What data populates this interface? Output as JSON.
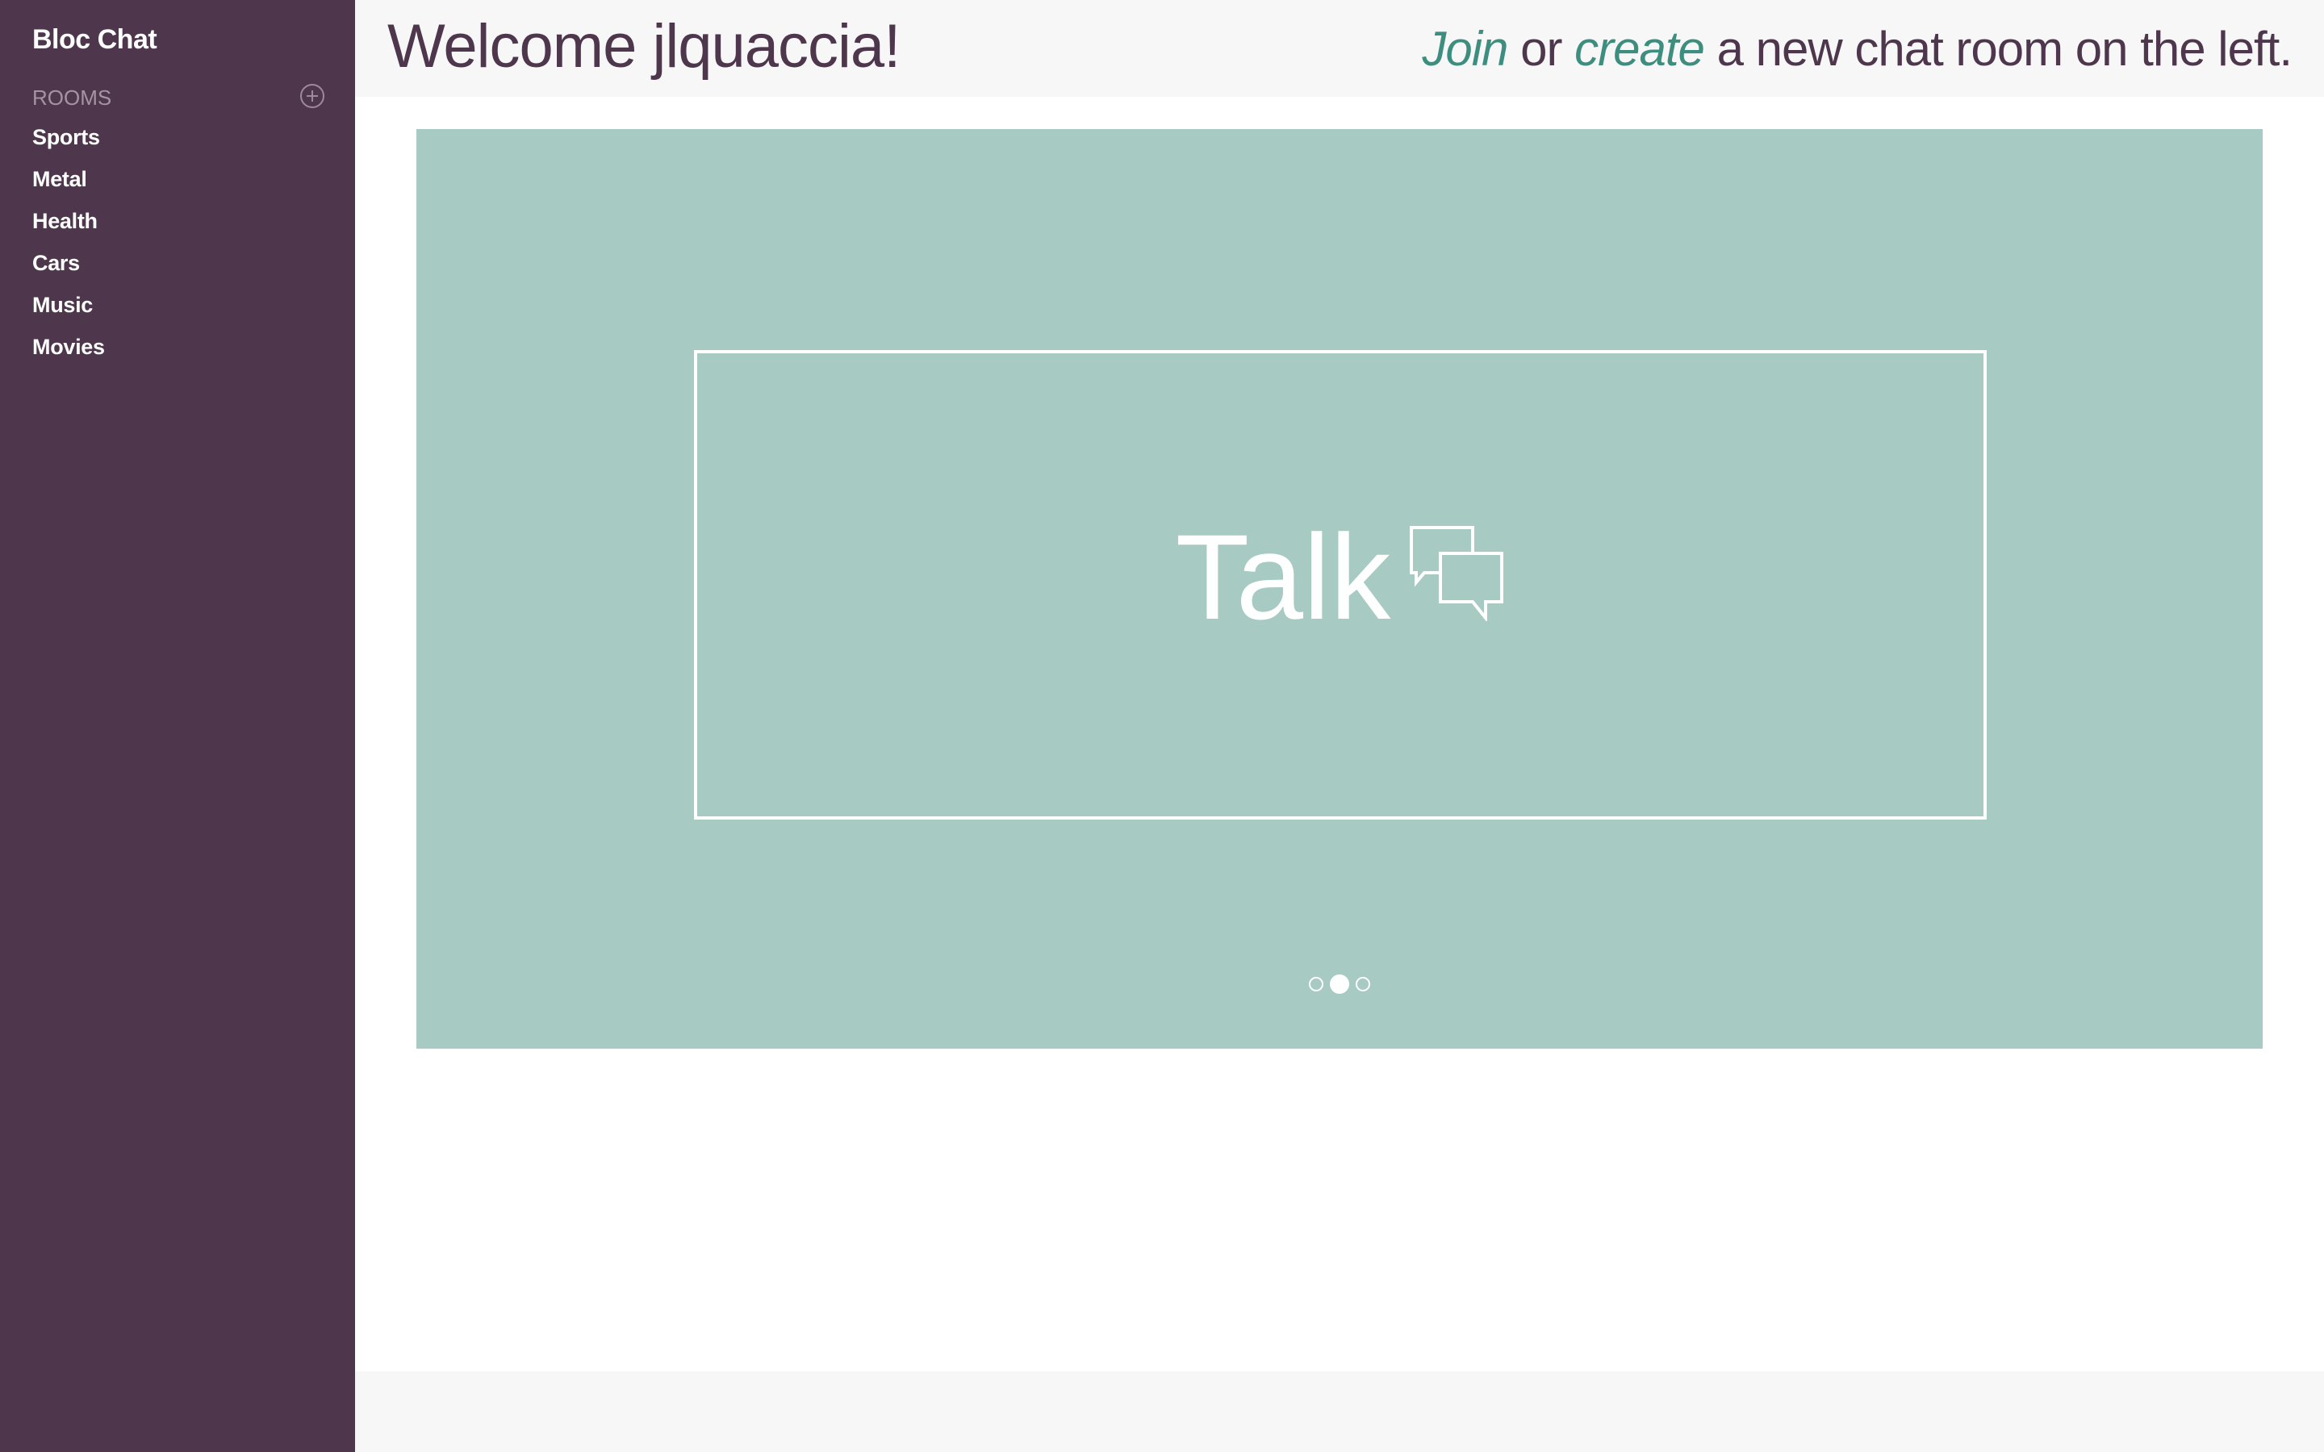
{
  "sidebar": {
    "brand": "Bloc Chat",
    "rooms_label": "ROOMS",
    "add_room_icon": "plus-circle-icon",
    "rooms": [
      {
        "label": "Sports"
      },
      {
        "label": "Metal"
      },
      {
        "label": "Health"
      },
      {
        "label": "Cars"
      },
      {
        "label": "Music"
      },
      {
        "label": "Movies"
      }
    ]
  },
  "header": {
    "welcome": "Welcome jlquaccia!",
    "join_link": "Join",
    "or_text": "or",
    "create_link": "create",
    "rest_text": "a new chat room on the left."
  },
  "carousel": {
    "slide_title": "Talk",
    "slide_icon": "chat-bubbles-icon",
    "slide_count": 3,
    "active_slide_index": 1
  },
  "colors": {
    "sidebar_bg": "#4e374c",
    "accent": "#3e8e7f",
    "carousel_bg": "#a7cac3",
    "header_bg": "#f7f7f7"
  }
}
